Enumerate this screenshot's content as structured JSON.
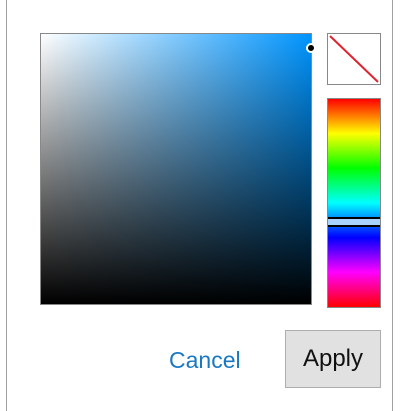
{
  "picker": {
    "hue_color": "#0095ff",
    "hue_fraction": 0.592,
    "saturation": 1.0,
    "value": 0.95,
    "no_color_icon": "no-color-slash-icon",
    "slash_color": "#e0242f"
  },
  "buttons": {
    "cancel_label": "Cancel",
    "apply_label": "Apply"
  },
  "colors": {
    "link": "#1a78c2",
    "button_bg": "#e1e1e1"
  }
}
